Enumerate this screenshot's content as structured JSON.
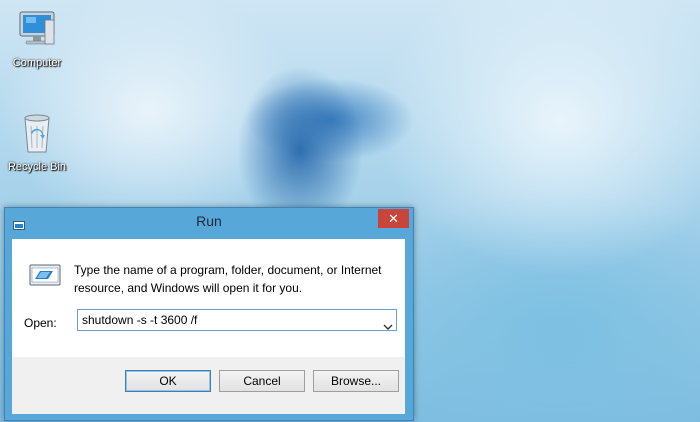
{
  "desktop": {
    "icons": [
      {
        "label": "Computer",
        "icon": "computer-icon"
      },
      {
        "label": "Recycle Bin",
        "icon": "recycle-bin-icon"
      }
    ]
  },
  "dialog": {
    "title": "Run",
    "title_icon": "run-icon",
    "close_label": "✕",
    "description": "Type the name of a program, folder, document, or Internet resource, and Windows will open it for you.",
    "open_label": "Open:",
    "open_value": "shutdown -s -t 3600 /f",
    "buttons": {
      "ok": "OK",
      "cancel": "Cancel",
      "browse": "Browse..."
    }
  },
  "colors": {
    "titlebar": "#57a7d8",
    "close": "#c9453b",
    "focus_border": "#3c7fb1"
  }
}
